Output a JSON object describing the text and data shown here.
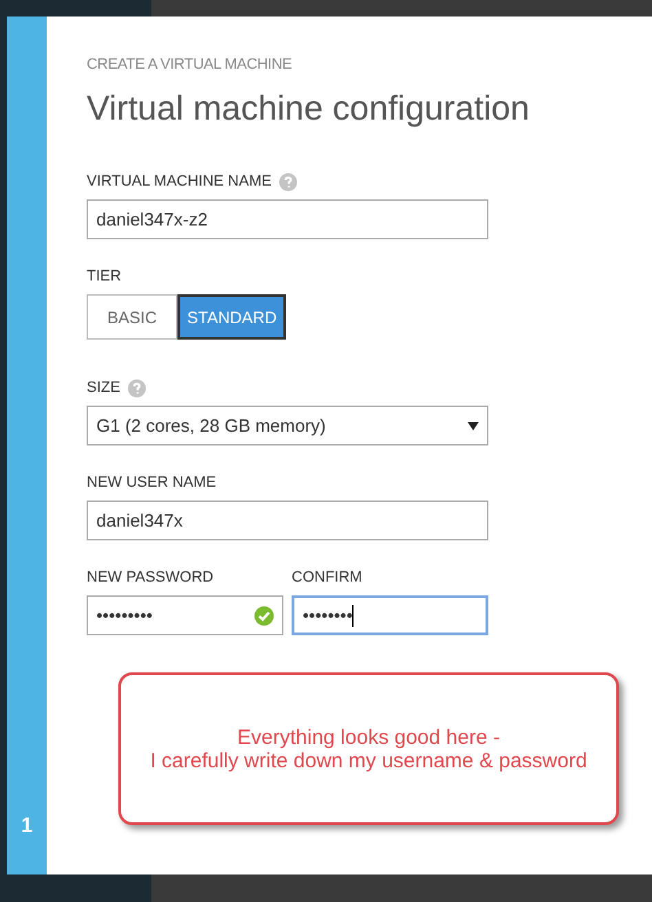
{
  "dialog": {
    "step": "1",
    "subtitle": "CREATE A VIRTUAL MACHINE",
    "title": "Virtual machine configuration"
  },
  "vm_name": {
    "label": "VIRTUAL MACHINE NAME",
    "help": true,
    "value": "daniel347x-z2"
  },
  "tier": {
    "label": "TIER",
    "options": [
      {
        "label": "BASIC",
        "selected": false
      },
      {
        "label": "STANDARD",
        "selected": true
      }
    ]
  },
  "size": {
    "label": "SIZE",
    "help": true,
    "value": "G1 (2 cores, 28 GB memory)"
  },
  "user_name": {
    "label": "NEW USER NAME",
    "value": "daniel347x"
  },
  "password": {
    "label": "NEW PASSWORD",
    "value": "•••••••••",
    "valid": true,
    "focused": false
  },
  "confirm": {
    "label": "CONFIRM",
    "value": "••••••••",
    "valid": false,
    "focused": true
  },
  "callout": {
    "lines": [
      "Everything looks good here -",
      "I carefully write down my username & password"
    ]
  }
}
